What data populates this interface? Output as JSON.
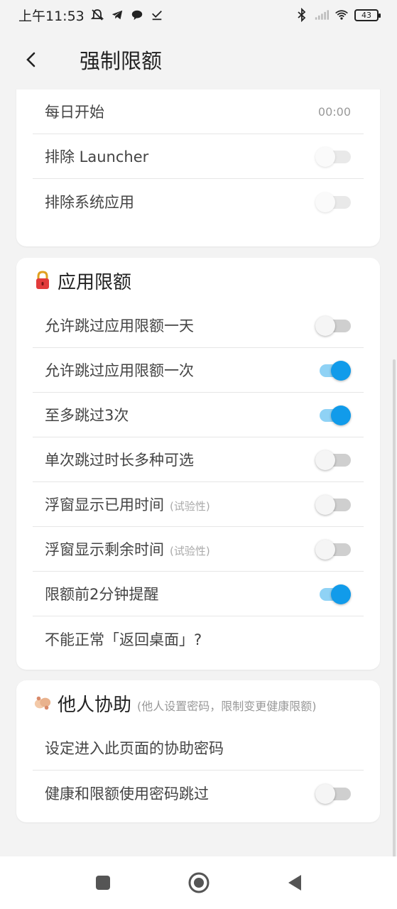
{
  "status": {
    "time": "上午11:53",
    "battery": "43"
  },
  "app_bar": {
    "title": "强制限额"
  },
  "general_card": {
    "rows": [
      {
        "label": "每日开始",
        "value": "00:00"
      },
      {
        "label": "排除 Launcher",
        "toggle": "disabled-off"
      },
      {
        "label": "排除系统应用",
        "toggle": "disabled-off"
      }
    ]
  },
  "app_limit_card": {
    "title": "应用限额",
    "icon": "lock-icon",
    "rows": [
      {
        "label": "允许跳过应用限额一天",
        "toggle": "off"
      },
      {
        "label": "允许跳过应用限额一次",
        "toggle": "on"
      },
      {
        "label": "至多跳过3次",
        "toggle": "on"
      },
      {
        "label": "单次跳过时长多种可选",
        "toggle": "off"
      },
      {
        "label": "浮窗显示已用时间",
        "tag": "(试验性)",
        "toggle": "off"
      },
      {
        "label": "浮窗显示剩余时间",
        "tag": "(试验性)",
        "toggle": "off"
      },
      {
        "label": "限额前2分钟提醒",
        "toggle": "on"
      },
      {
        "label": "不能正常「返回桌面」?"
      }
    ]
  },
  "assist_card": {
    "title": "他人协助",
    "subtitle": "(他人设置密码，限制变更健康限额)",
    "icon": "handshake-icon",
    "rows": [
      {
        "label": "设定进入此页面的协助密码"
      },
      {
        "label": "健康和限额使用密码跳过",
        "toggle": "off"
      }
    ]
  },
  "colors": {
    "accent": "#119bea",
    "accent_track": "#8fd2f5",
    "background": "#f3f3f3"
  }
}
